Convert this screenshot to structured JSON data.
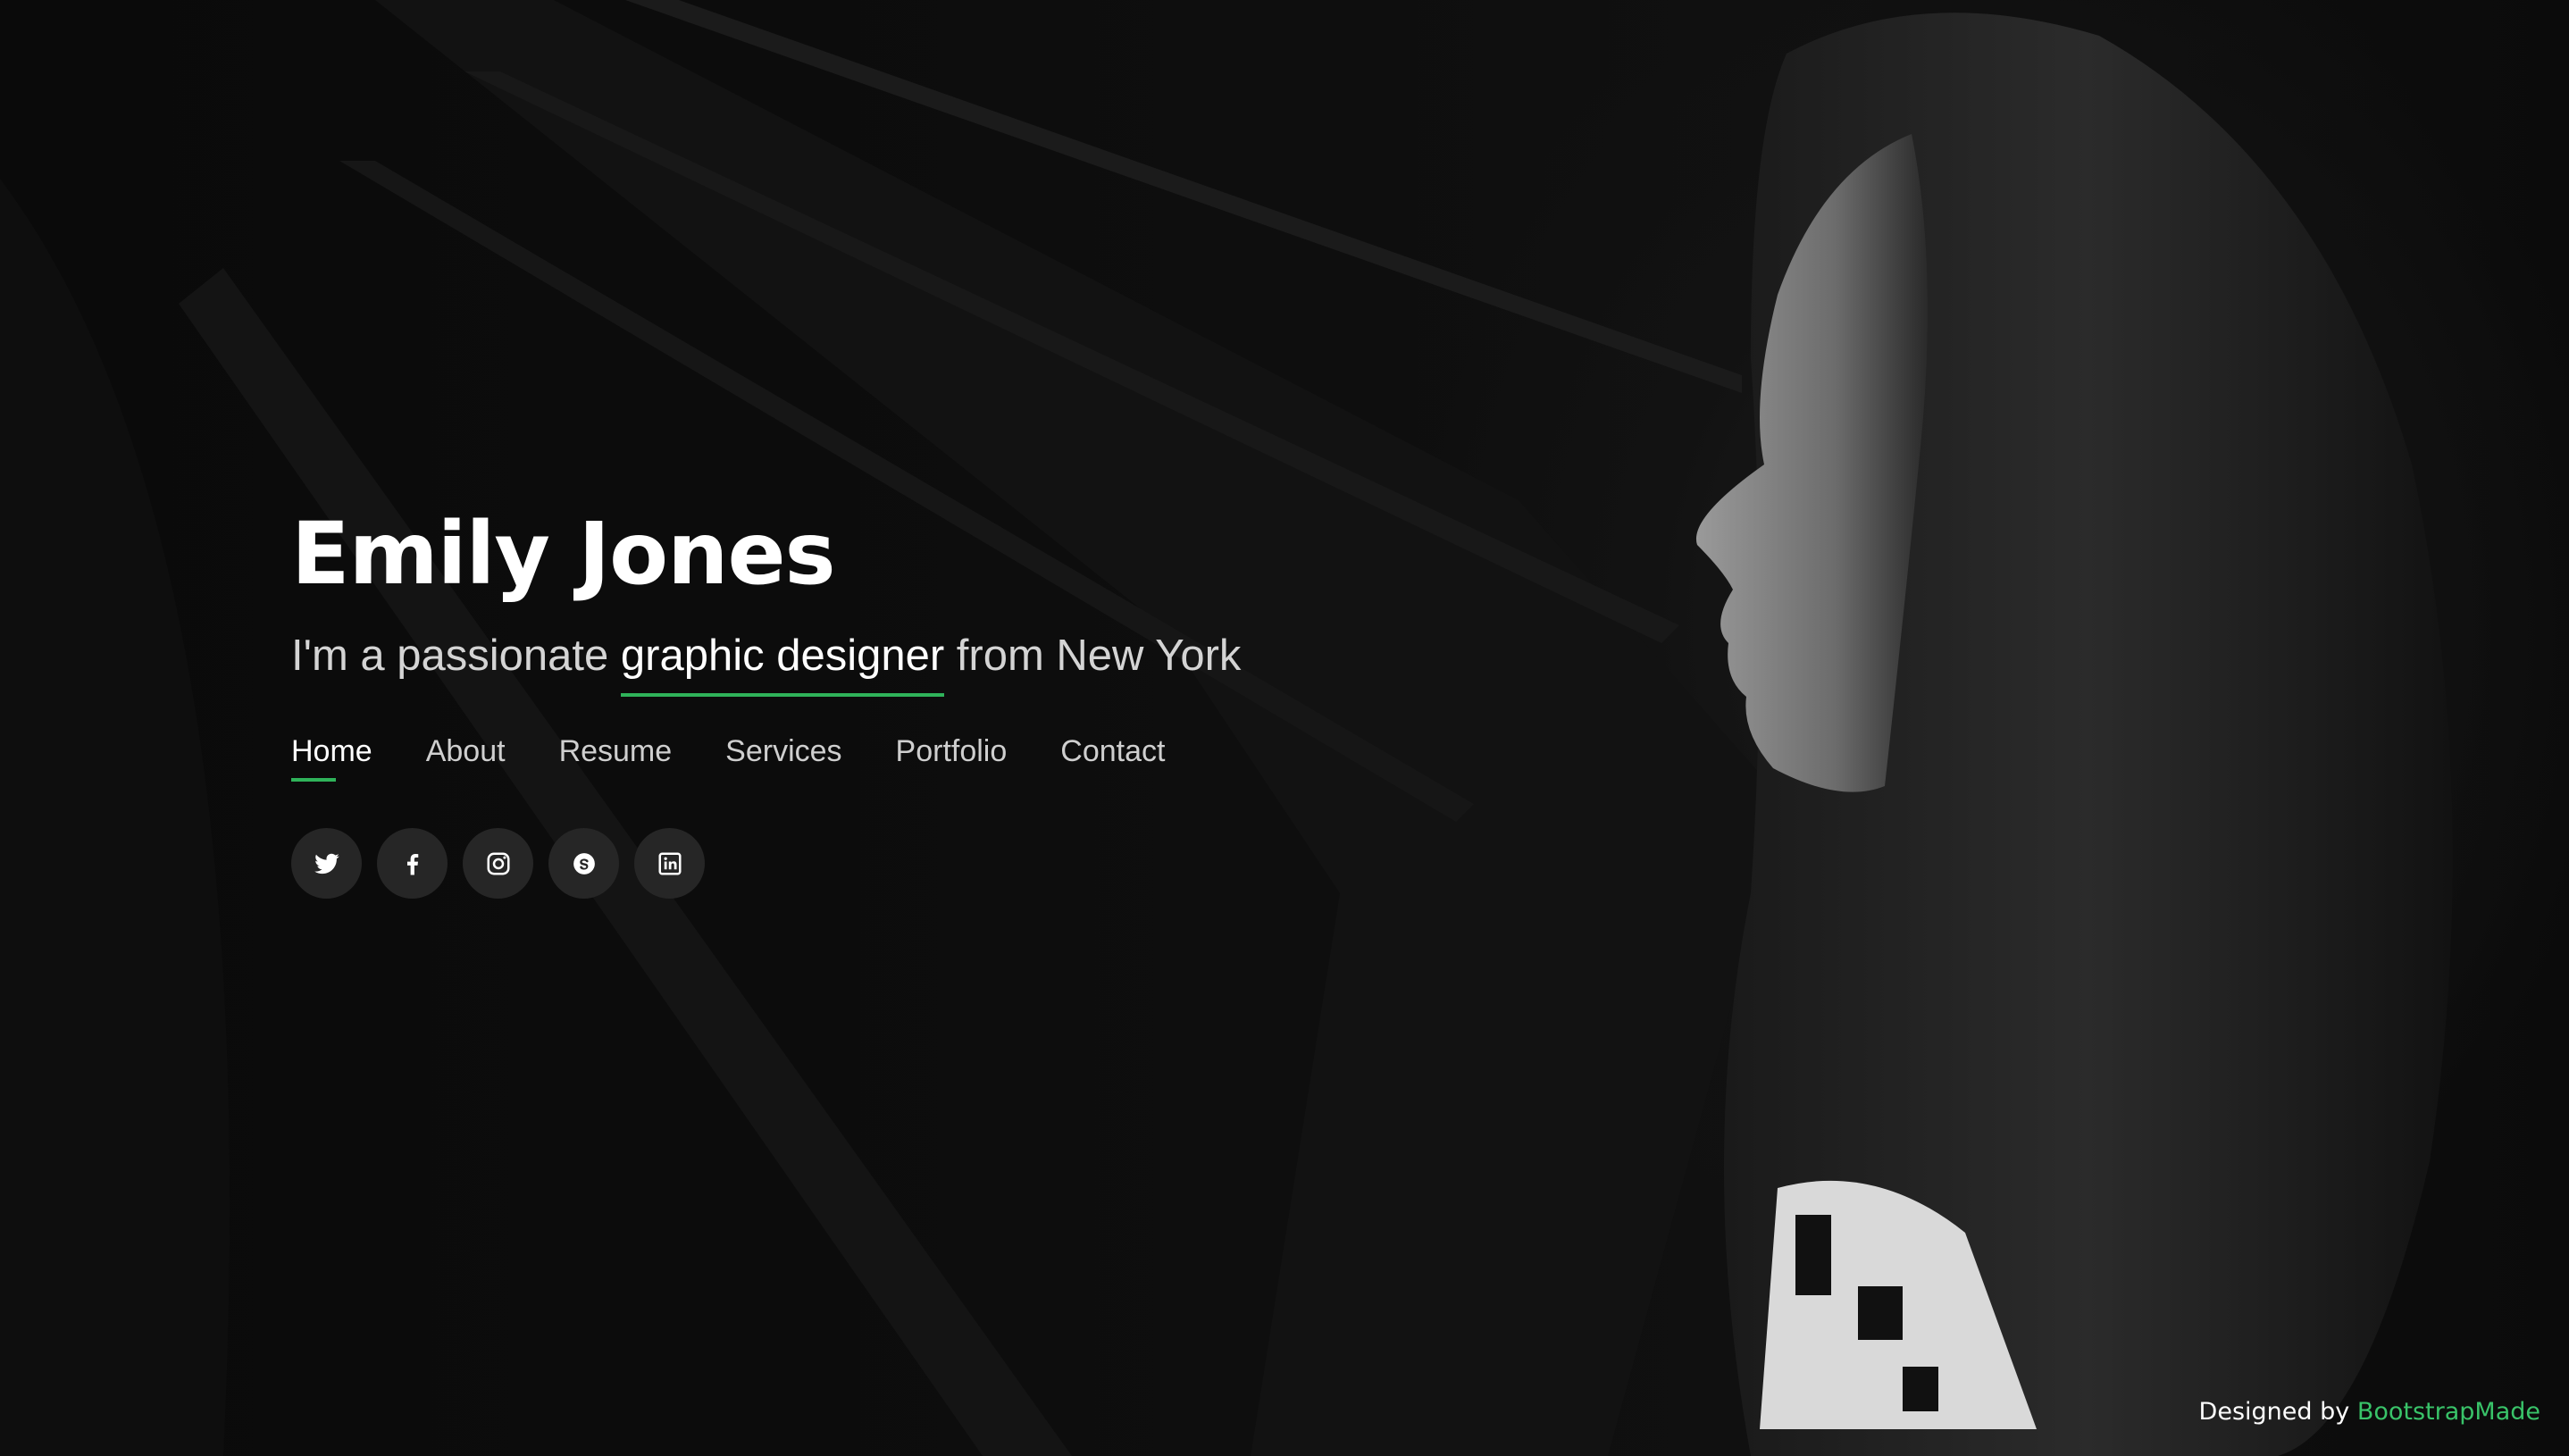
{
  "hero": {
    "name": "Emily Jones",
    "tagline_prefix": "I'm a passionate ",
    "tagline_typed": "graphic designer",
    "tagline_suffix": " from New York"
  },
  "nav": {
    "items": [
      {
        "label": "Home",
        "active": true
      },
      {
        "label": "About",
        "active": false
      },
      {
        "label": "Resume",
        "active": false
      },
      {
        "label": "Services",
        "active": false
      },
      {
        "label": "Portfolio",
        "active": false
      },
      {
        "label": "Contact",
        "active": false
      }
    ]
  },
  "social": {
    "icons": [
      "twitter-icon",
      "facebook-icon",
      "instagram-icon",
      "skype-icon",
      "linkedin-icon"
    ]
  },
  "footer": {
    "designed_by": "Designed by",
    "designer_link": "BootstrapMade"
  },
  "colors": {
    "accent": "#2fb35a",
    "background": "#0b0b0b",
    "social_button_bg": "#262626"
  },
  "background_image": {
    "icon": "portrait-photo"
  }
}
